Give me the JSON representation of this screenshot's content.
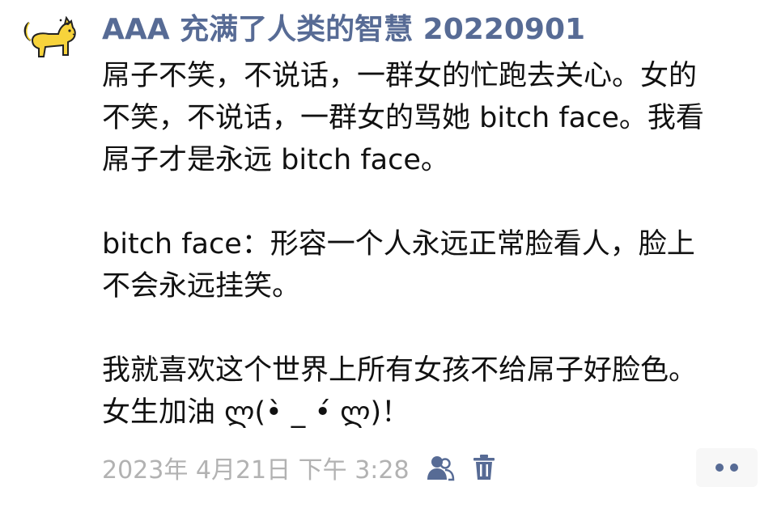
{
  "post": {
    "author": "AAA 充满了人类的智慧 20220901",
    "paragraphs": [
      {
        "lines": [
          "屌子不笑，不说话，一群女的忙跑去关心。女的",
          "不笑，不说话，一群女的骂她 bitch face。我看",
          "屌子才是永远 bitch face。"
        ]
      },
      {
        "lines": [
          "bitch face：形容一个人永远正常脸看人，脸上",
          "不会永远挂笑。"
        ]
      },
      {
        "lines": [
          "我就喜欢这个世界上所有女孩不给屌子好脸色。",
          "女生加油 ლ(•̀ _ •́ ლ)！"
        ]
      }
    ],
    "timestamp": "2023年 4月21日 下午 3:28",
    "avatar_icon": "yellow-cat-avatar",
    "visibility_icon": "people-icon",
    "delete_icon": "trash-icon",
    "more_icon": "more-dots-icon",
    "colors": {
      "author": "#576b95",
      "body_text": "#111111",
      "timestamp": "#b2b2b2",
      "icons": "#576b95",
      "more_button_bg": "#f7f7f7"
    }
  }
}
